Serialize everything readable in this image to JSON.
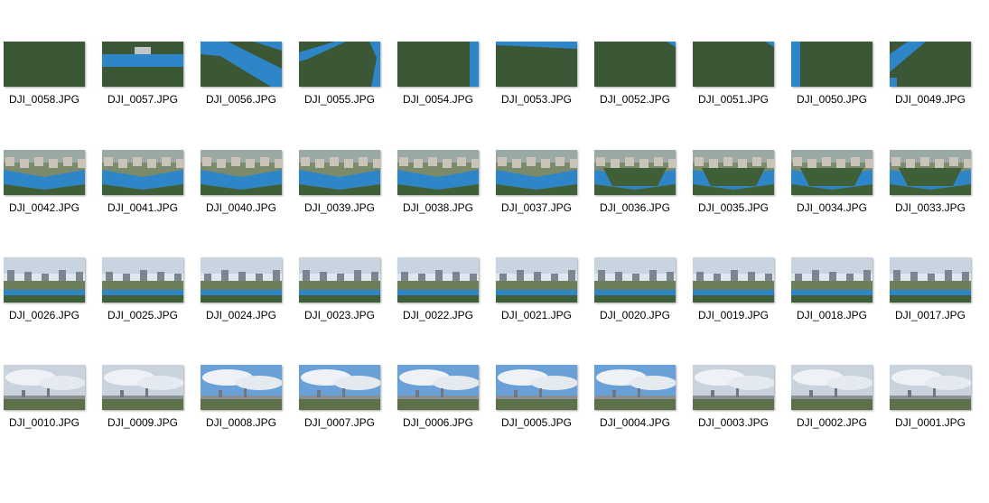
{
  "rows": [
    {
      "kind": "grass",
      "items": [
        {
          "file": "DJI_0058.JPG",
          "blue": "none"
        },
        {
          "file": "DJI_0057.JPG",
          "blue": "band"
        },
        {
          "file": "DJI_0056.JPG",
          "blue": "diag"
        },
        {
          "file": "DJI_0055.JPG",
          "blue": "corner"
        },
        {
          "file": "DJI_0054.JPG",
          "blue": "side"
        },
        {
          "file": "DJI_0053.JPG",
          "blue": "top"
        },
        {
          "file": "DJI_0052.JPG",
          "blue": "topright"
        },
        {
          "file": "DJI_0051.JPG",
          "blue": "topright"
        },
        {
          "file": "DJI_0050.JPG",
          "blue": "leftstrip"
        },
        {
          "file": "DJI_0049.JPG",
          "blue": "leftdiag"
        }
      ]
    },
    {
      "kind": "field",
      "items": [
        {
          "file": "DJI_0042.JPG"
        },
        {
          "file": "DJI_0041.JPG"
        },
        {
          "file": "DJI_0040.JPG"
        },
        {
          "file": "DJI_0039.JPG"
        },
        {
          "file": "DJI_0038.JPG"
        },
        {
          "file": "DJI_0037.JPG"
        },
        {
          "file": "DJI_0036.JPG"
        },
        {
          "file": "DJI_0035.JPG"
        },
        {
          "file": "DJI_0034.JPG"
        },
        {
          "file": "DJI_0033.JPG"
        }
      ]
    },
    {
      "kind": "skyline",
      "items": [
        {
          "file": "DJI_0026.JPG"
        },
        {
          "file": "DJI_0025.JPG"
        },
        {
          "file": "DJI_0024.JPG"
        },
        {
          "file": "DJI_0023.JPG"
        },
        {
          "file": "DJI_0022.JPG"
        },
        {
          "file": "DJI_0021.JPG"
        },
        {
          "file": "DJI_0020.JPG"
        },
        {
          "file": "DJI_0019.JPG"
        },
        {
          "file": "DJI_0018.JPG"
        },
        {
          "file": "DJI_0017.JPG"
        }
      ]
    },
    {
      "kind": "sky",
      "items": [
        {
          "file": "DJI_0010.JPG"
        },
        {
          "file": "DJI_0009.JPG"
        },
        {
          "file": "DJI_0008.JPG"
        },
        {
          "file": "DJI_0007.JPG"
        },
        {
          "file": "DJI_0006.JPG"
        },
        {
          "file": "DJI_0005.JPG"
        },
        {
          "file": "DJI_0004.JPG"
        },
        {
          "file": "DJI_0003.JPG"
        },
        {
          "file": "DJI_0002.JPG"
        },
        {
          "file": "DJI_0001.JPG"
        }
      ]
    }
  ],
  "colors": {
    "grass": "#3f5f38",
    "grass_dark": "#354a33",
    "track_blue": "#2e86c9",
    "building": "#c9c3b8",
    "sky_light": "#dfe6ee",
    "sky_blue": "#6aa0d8"
  }
}
